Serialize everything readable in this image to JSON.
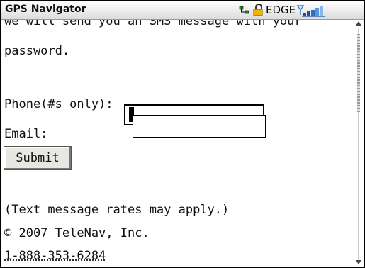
{
  "status_bar": {
    "app_title": "GPS Navigator",
    "network": "EDGE",
    "icons": [
      "bluetooth-icon",
      "lock-icon",
      "signal-strength-icon"
    ],
    "signal_color": "#3a78c8"
  },
  "content": {
    "intro_line1": "we will send you an SMS message with your",
    "intro_line2": "password.",
    "phone_label": "Phone(#s only):",
    "phone_value": "",
    "email_label": "Email:",
    "email_value": "",
    "submit_label": "Submit",
    "rates_note": "(Text message rates may apply.)",
    "copyright": "© 2007 TeleNav, Inc.",
    "phone_link": "1-888-353-6284"
  }
}
